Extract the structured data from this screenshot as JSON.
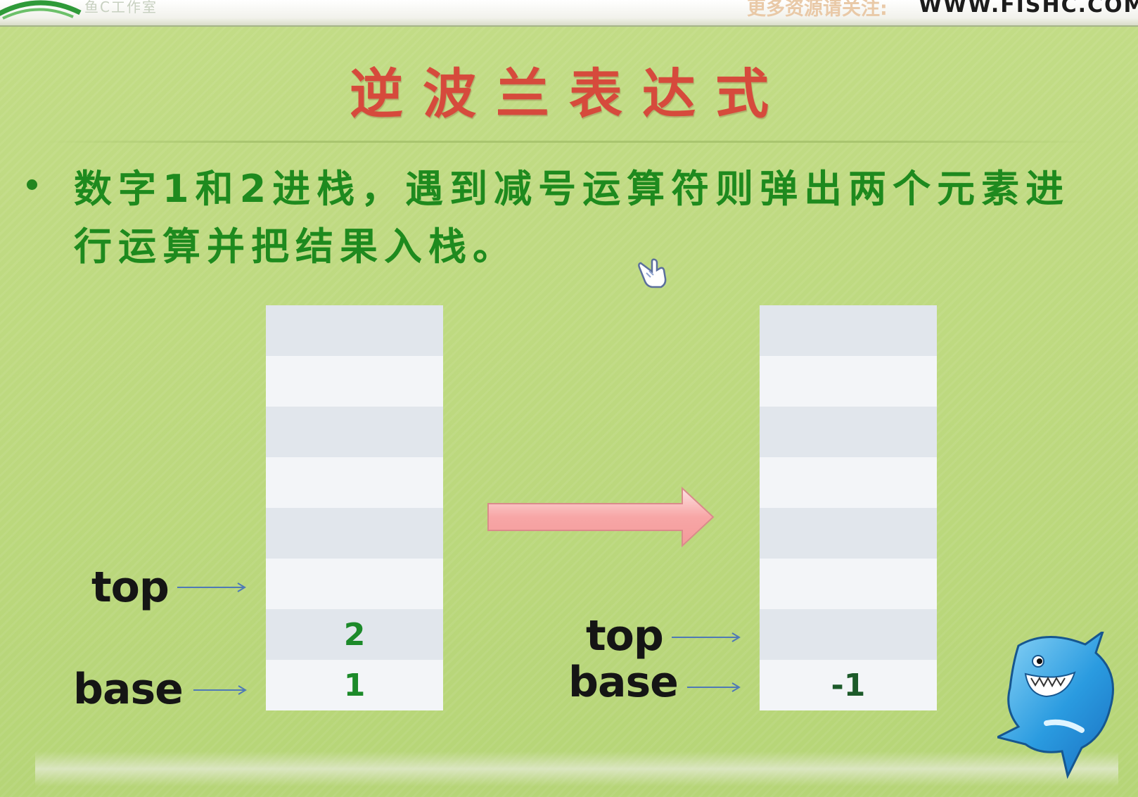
{
  "header": {
    "logo_text": "鱼C工作室",
    "site_label": "更多资源请关注:",
    "site_url": "WWW.FISHC.COM"
  },
  "slide": {
    "title": "逆波兰表达式",
    "bullet": "数字1和2进栈，遇到减号运算符则弹出两个元素进行运算并把结果入栈。"
  },
  "diagram": {
    "left_stack": {
      "cells": [
        "",
        "",
        "",
        "",
        "",
        "",
        "2",
        "1"
      ],
      "top_label": "top",
      "base_label": "base"
    },
    "right_stack": {
      "cells": [
        "",
        "",
        "",
        "",
        "",
        "",
        "",
        "-1"
      ],
      "top_label": "top",
      "base_label": "base"
    }
  },
  "colors": {
    "background": "#bfd981",
    "title": "#d64a3c",
    "bullet_text": "#1e8a1e",
    "stack_value": "#1c8a2a",
    "transition_arrow": "#f7a6a6"
  }
}
